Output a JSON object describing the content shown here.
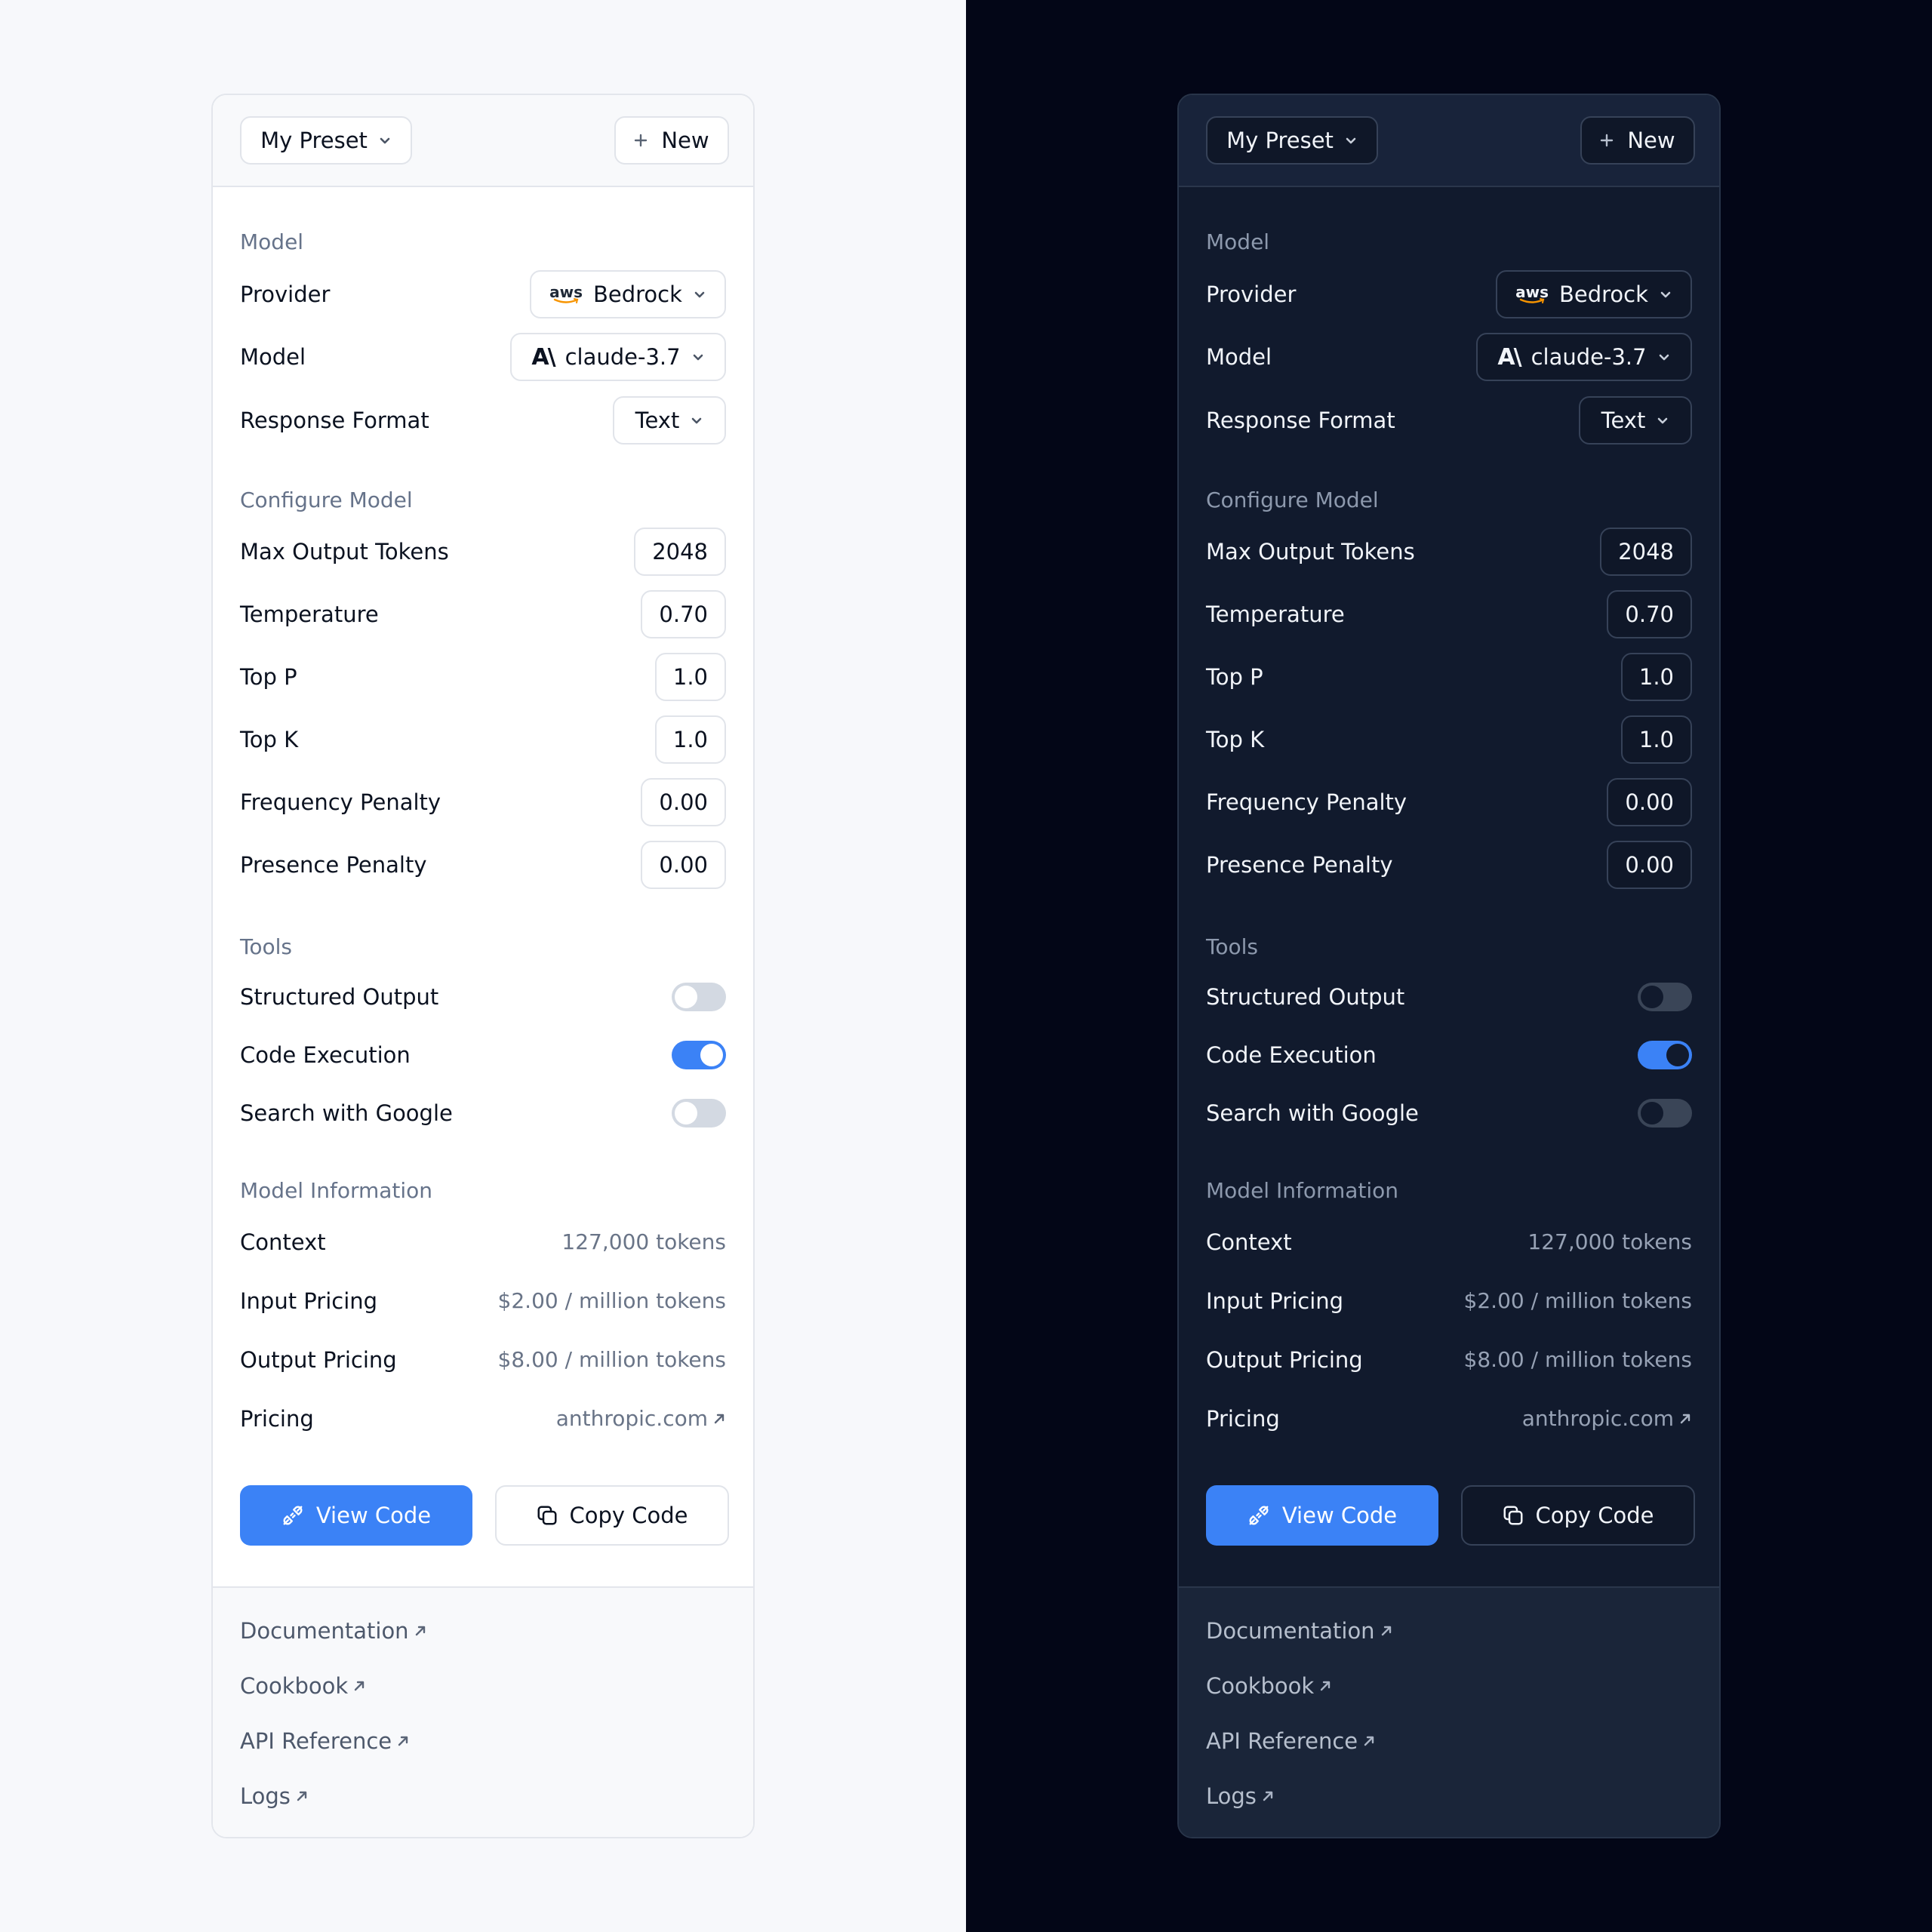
{
  "header": {
    "preset_label": "My Preset",
    "new_label": "New"
  },
  "model_section": {
    "title": "Model",
    "provider_label": "Provider",
    "provider_value": "Bedrock",
    "provider_logo_text": "aws",
    "model_label": "Model",
    "model_value": "claude-3.7",
    "model_logo_text": "A\\",
    "format_label": "Response Format",
    "format_value": "Text"
  },
  "configure": {
    "title": "Configure Model",
    "rows": [
      {
        "label": "Max Output Tokens",
        "value": "2048"
      },
      {
        "label": "Temperature",
        "value": "0.70"
      },
      {
        "label": "Top P",
        "value": "1.0"
      },
      {
        "label": "Top K",
        "value": "1.0"
      },
      {
        "label": "Frequency Penalty",
        "value": "0.00"
      },
      {
        "label": "Presence Penalty",
        "value": "0.00"
      }
    ]
  },
  "tools": {
    "title": "Tools",
    "items": [
      {
        "label": "Structured Output",
        "enabled": false
      },
      {
        "label": "Code Execution",
        "enabled": true
      },
      {
        "label": "Search with Google",
        "enabled": false
      }
    ]
  },
  "info": {
    "title": "Model Information",
    "rows": [
      {
        "label": "Context",
        "value": "127,000 tokens"
      },
      {
        "label": "Input Pricing",
        "value": "$2.00 / million tokens"
      },
      {
        "label": "Output Pricing",
        "value": "$8.00 / million tokens"
      },
      {
        "label": "Pricing",
        "value": "anthropic.com"
      }
    ]
  },
  "actions": {
    "view_code": "View Code",
    "copy_code": "Copy Code"
  },
  "footer_links": [
    "Documentation",
    "Cookbook",
    "API Reference",
    "Logs"
  ],
  "colors": {
    "accent": "#3b82f6",
    "light_bg": "#f7f8fb",
    "dark_bg": "#030617",
    "dark_panel": "#111a2d"
  },
  "themes": [
    "light",
    "dark"
  ]
}
